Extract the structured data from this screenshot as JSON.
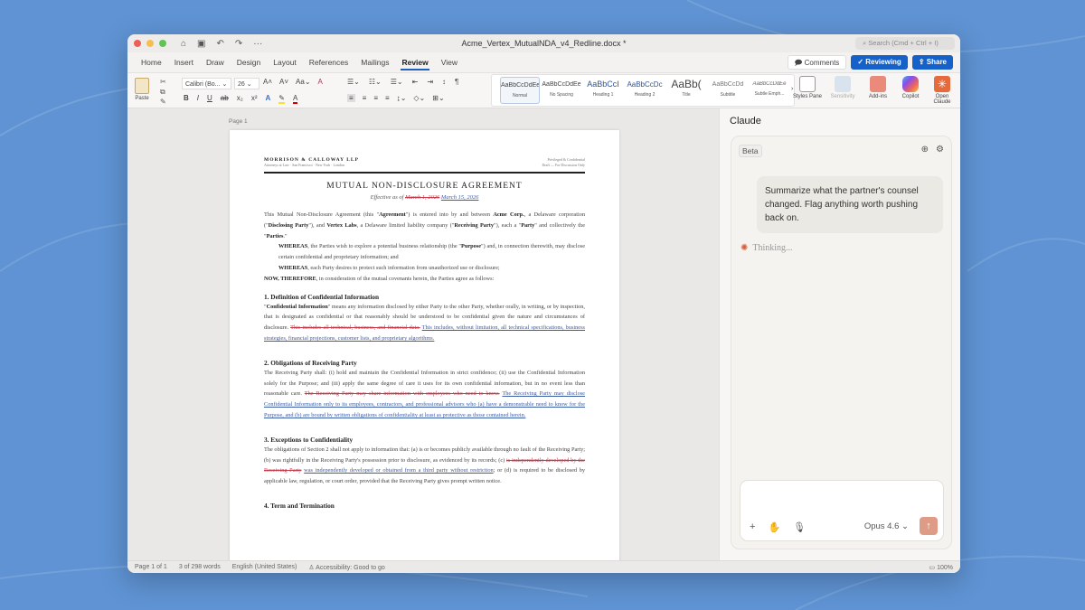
{
  "window": {
    "title": "Acme_Vertex_MutualNDA_v4_Redline.docx *",
    "search_placeholder": "Search (Cmd + Ctrl + I)",
    "traffic_colors": [
      "#ee5f57",
      "#f6be4f",
      "#5fc454"
    ]
  },
  "tabs": [
    "Home",
    "Insert",
    "Draw",
    "Design",
    "Layout",
    "References",
    "Mailings",
    "Review",
    "View"
  ],
  "active_tab": "Review",
  "header_buttons": {
    "comments": "Comments",
    "reviewing": "Reviewing",
    "share": "Share",
    "accent": "#1560c9"
  },
  "ribbon": {
    "paste": "Paste",
    "font": "Calibri (Bo...",
    "size": "26",
    "styles": [
      {
        "sample": "AaBbCcDdEe",
        "label": "Normal"
      },
      {
        "sample": "AaBbCcDdEe",
        "label": "No Spacing"
      },
      {
        "sample": "AaBbCcI",
        "label": "Heading 1"
      },
      {
        "sample": "AaBbCcDc",
        "label": "Heading 2"
      },
      {
        "sample": "AaBb(",
        "label": "Title"
      },
      {
        "sample": "AaBbCcDd",
        "label": "Subtitle"
      },
      {
        "sample": "AaBbCcDdEe",
        "label": "Subtle Emph..."
      }
    ],
    "styles_pane": "Styles Pane",
    "sensitivity": "Sensitivity",
    "addins": "Add-ins",
    "copilot": "Copilot",
    "open_claude": "Open Claude"
  },
  "document": {
    "page_label": "Page 1",
    "firm": "MORRISON & CALLOWAY LLP",
    "firm_sub": "Attorneys at Law · San Francisco · New York · London",
    "header_right": [
      "Privileged & Confidential",
      "Draft — For Discussion Only"
    ],
    "title": "MUTUAL NON-DISCLOSURE AGREEMENT",
    "effective": [
      {
        "t": "n",
        "v": "Effective as of "
      },
      {
        "t": "del",
        "v": "March 1, 2026"
      },
      {
        "t": "n",
        "v": " "
      },
      {
        "t": "ins",
        "v": "March 15, 2026"
      }
    ],
    "blocks": [
      {
        "kind": "p",
        "segs": [
          {
            "t": "n",
            "v": "This Mutual Non-Disclosure Agreement (this \""
          },
          {
            "t": "b",
            "v": "Agreement"
          },
          {
            "t": "n",
            "v": "\") is entered into by and between "
          },
          {
            "t": "b",
            "v": "Acme Corp."
          },
          {
            "t": "n",
            "v": ", a Delaware corporation (\""
          },
          {
            "t": "b",
            "v": "Disclosing Party"
          },
          {
            "t": "n",
            "v": "\"), and "
          },
          {
            "t": "b",
            "v": "Vertex Labs"
          },
          {
            "t": "n",
            "v": ", a Delaware limited liability company (\""
          },
          {
            "t": "b",
            "v": "Receiving Party"
          },
          {
            "t": "n",
            "v": "\"), each a \""
          },
          {
            "t": "b",
            "v": "Party"
          },
          {
            "t": "n",
            "v": "\" and collectively the \""
          },
          {
            "t": "b",
            "v": "Parties"
          },
          {
            "t": "n",
            "v": ".\""
          }
        ]
      },
      {
        "kind": "ind",
        "segs": [
          {
            "t": "b",
            "v": "WHEREAS"
          },
          {
            "t": "n",
            "v": ", the Parties wish to explore a potential business relationship (the \""
          },
          {
            "t": "b",
            "v": "Purpose"
          },
          {
            "t": "n",
            "v": "\") and, in connection therewith, may disclose certain confidential and proprietary information; and"
          }
        ]
      },
      {
        "kind": "ind",
        "segs": [
          {
            "t": "b",
            "v": "WHEREAS"
          },
          {
            "t": "n",
            "v": ", each Party desires to protect such information from unauthorized use or disclosure;"
          }
        ]
      },
      {
        "kind": "p",
        "segs": [
          {
            "t": "b",
            "v": "NOW, THEREFORE"
          },
          {
            "t": "n",
            "v": ", in consideration of the mutual covenants herein, the Parties agree as follows:"
          }
        ]
      },
      {
        "kind": "h",
        "segs": [
          {
            "t": "n",
            "v": "1. Definition of Confidential Information"
          }
        ]
      },
      {
        "kind": "p",
        "segs": [
          {
            "t": "n",
            "v": "\""
          },
          {
            "t": "b",
            "v": "Confidential Information"
          },
          {
            "t": "n",
            "v": "\" means any information disclosed by either Party to the other Party, whether orally, in writing, or by inspection, that is designated as confidential or that reasonably should be understood to be confidential given the nature and circumstances of disclosure. "
          },
          {
            "t": "del",
            "v": "This includes all technical, business, and financial data."
          },
          {
            "t": "n",
            "v": " "
          },
          {
            "t": "ins",
            "v": "This includes, without limitation, all technical specifications, business strategies, financial projections, customer lists, and proprietary algorithms."
          }
        ]
      },
      {
        "kind": "h",
        "segs": [
          {
            "t": "n",
            "v": "2. Obligations of Receiving Party"
          }
        ]
      },
      {
        "kind": "p",
        "segs": [
          {
            "t": "n",
            "v": "The Receiving Party shall: (i) hold and maintain the Confidential Information in strict confidence; (ii) use the Confidential Information solely for the Purpose; and (iii) apply the same degree of care it uses for its own confidential information, but in no event less than reasonable care. "
          },
          {
            "t": "del",
            "v": "The Receiving Party may share information with employees who need to know."
          },
          {
            "t": "n",
            "v": " "
          },
          {
            "t": "ins",
            "v": "The Receiving Party may disclose Confidential Information only to its employees, contractors, and professional advisors who (a) have a demonstrable need to know for the Purpose, and (b) are bound by written obligations of confidentiality at least as protective as those contained herein."
          }
        ]
      },
      {
        "kind": "h",
        "segs": [
          {
            "t": "n",
            "v": "3. Exceptions to Confidentiality"
          }
        ]
      },
      {
        "kind": "p",
        "segs": [
          {
            "t": "n",
            "v": "The obligations of Section 2 shall not apply to information that: (a) is or becomes publicly available through no fault of the Receiving Party; (b) was rightfully in the Receiving Party's possession prior to disclosure, as evidenced by its records; (c) "
          },
          {
            "t": "del",
            "v": "is independently developed by the Receiving Party"
          },
          {
            "t": "n",
            "v": " "
          },
          {
            "t": "ins",
            "v": "was independently developed or obtained from a third party without restriction"
          },
          {
            "t": "n",
            "v": "; or (d) is required to be disclosed by applicable law, regulation, or court order, provided that the Receiving Party gives prompt written notice."
          }
        ]
      },
      {
        "kind": "h",
        "segs": [
          {
            "t": "n",
            "v": "4. Term and Termination"
          }
        ]
      }
    ]
  },
  "claude": {
    "title": "Claude",
    "badge": "Beta",
    "user_message": "Summarize what the partner's counsel changed. Flag anything worth pushing back on.",
    "thinking": "Thinking...",
    "model": "Opus 4.6",
    "accent": "#d2613c"
  },
  "status": {
    "page": "Page 1 of 1",
    "words": "3 of 298 words",
    "language": "English (United States)",
    "accessibility": "Accessibility: Good to go",
    "zoom": "100%"
  }
}
